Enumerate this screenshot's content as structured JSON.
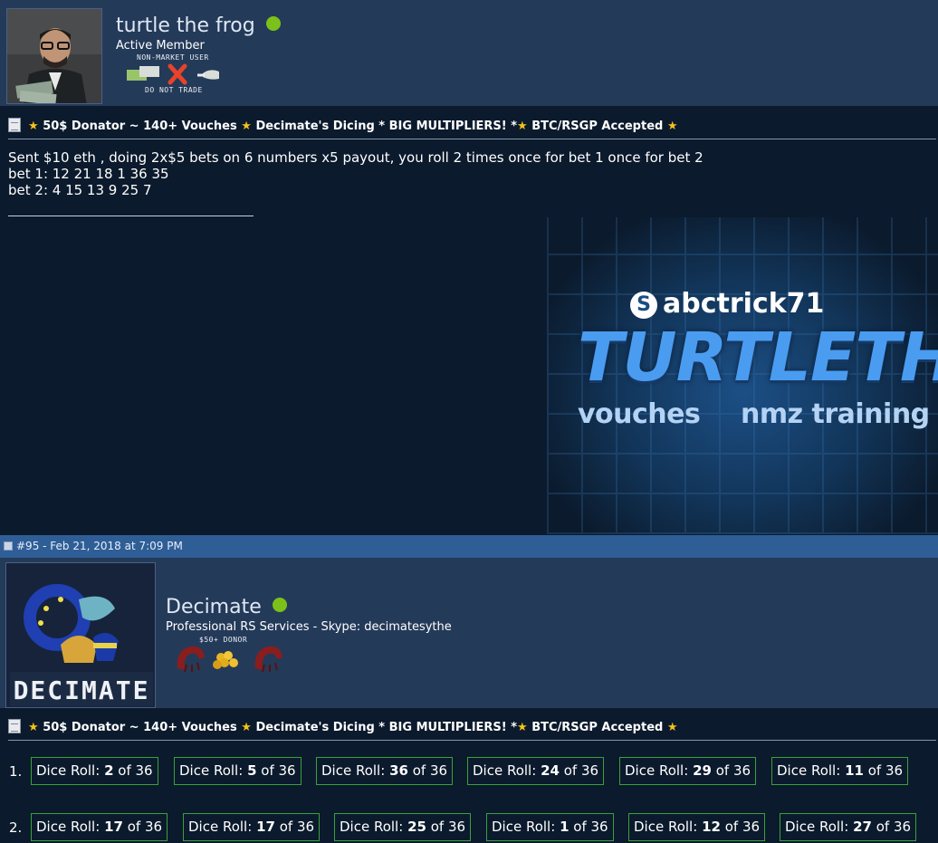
{
  "post1": {
    "username": "turtle the frog",
    "user_title": "Active Member",
    "badge_caption_top": "NON-MARKET USER",
    "badge_caption_bottom": "DO NOT TRADE",
    "signature": {
      "star": "★",
      "part1": "50$ Donator ~ 140+ Vouches",
      "part2": "Decimate's Dicing * BIG MULTIPLIERS! *",
      "part3": "BTC/RSGP Accepted"
    },
    "body_lines": [
      "Sent $10 eth , doing 2x$5 bets on 6 numbers x5 payout, you roll 2 times once for bet 1 once for bet 2",
      "bet 1: 12 21 18 1 36 35",
      "bet 2: 4 15 13 9 25 7"
    ],
    "banner": {
      "skype_logo": "S",
      "skype_name": "abctrick71",
      "title": "TURTLETHE",
      "sub1": "vouches",
      "sub2": "nmz training"
    }
  },
  "post2": {
    "header": "#95 - Feb 21, 2018 at 7:09 PM",
    "username": "Decimate",
    "user_title": "Professional RS Services - Skype: decimatesythe",
    "badge_caption": "$50+ DONOR",
    "avatar_text": "DECIMATE",
    "signature": {
      "star": "★",
      "part1": "50$ Donator ~ 140+ Vouches",
      "part2": "Decimate's Dicing * BIG MULTIPLIERS! *",
      "part3": "BTC/RSGP Accepted"
    },
    "dice_label": "Dice Roll:",
    "dice_of": "of 36",
    "rows": [
      {
        "index": "1.",
        "rolls": [
          "2",
          "5",
          "36",
          "24",
          "29",
          "11"
        ]
      },
      {
        "index": "2.",
        "rolls": [
          "17",
          "17",
          "25",
          "1",
          "12",
          "27"
        ]
      }
    ]
  },
  "colors": {
    "online": "#7cc11a",
    "star": "#f4c21a",
    "dice_border": "#3aa13a",
    "post_header": "#2f5e97"
  }
}
